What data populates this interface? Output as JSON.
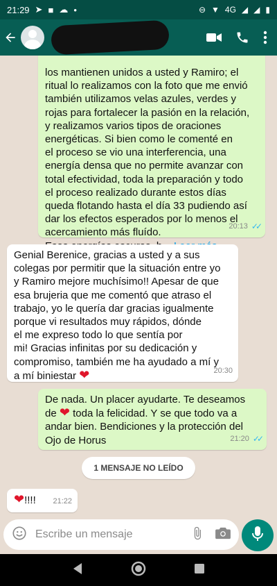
{
  "status": {
    "time": "21:29",
    "network": "4G"
  },
  "header": {
    "back_icon": "arrow-back-icon",
    "video_icon": "videocam-icon",
    "call_icon": "phone-icon",
    "menu_icon": "more-vert-icon"
  },
  "messages": [
    {
      "type": "out",
      "lines": [
        "los mantienen unidos a usted y Ramiro; el",
        "ritual lo realizamos con la foto que me envió",
        "también utilizamos velas azules, verdes y",
        "rojas para fortalecer la pasión en la relación,",
        "y realizamos varios tipos de oraciones",
        "energéticas. Si bien como le comenté en",
        "el proceso se vio una interferencia, una",
        "energía densa que no permite avanzar con",
        "total efectividad, toda la preparación y todo",
        "el proceso realizado durante estos días",
        "queda flotando hasta el día 33 pudiendo así",
        "dar los efectos esperados por lo menos el",
        "acercamiento más fluído."
      ],
      "last_line": "Esas energías oscuras, b...",
      "read_more": "Leer más",
      "time": "20:13"
    },
    {
      "type": "in",
      "lines": [
        "Genial Berenice, gracias a usted y a sus",
        "colegas por permitir que la situación entre yo",
        "y Ramiro mejore muchísimo!! Apesar de que",
        "esa brujeria que me comentó que atraso el",
        "trabajo, yo le quería dar gracias igualmente",
        "porque vi resultados muy rápidos, dónde",
        "el me expreso todo lo que sentía por",
        "mi! Gracias infinitas por su dedicación y",
        "compromiso, también me ha ayudado a mí y"
      ],
      "last_line": "a mí biniestar",
      "emoji": "❤",
      "time": "20:30"
    },
    {
      "type": "out",
      "line1": "De nada. Un placer ayudarte. Te deseamos",
      "line2_a": "de",
      "emoji": "❤",
      "line2_b": "toda la felicidad. Y se que todo va a",
      "line3": "andar bien. Bendiciones y la protección del",
      "line4": "Ojo de Horus",
      "time": "21:20"
    },
    {
      "type": "in",
      "emoji": "❤",
      "text": "!!!!",
      "time": "21:22"
    }
  ],
  "unread_label": "1 MENSAJE NO LEÍDO",
  "composer": {
    "placeholder": "Escribe un mensaje",
    "emoji_icon": "emoji-icon",
    "attach_icon": "attach-icon",
    "camera_icon": "camera-icon",
    "mic_icon": "mic-icon"
  },
  "nav": {
    "back": "nav-back-icon",
    "home": "nav-home-icon",
    "recents": "nav-recents-icon"
  }
}
